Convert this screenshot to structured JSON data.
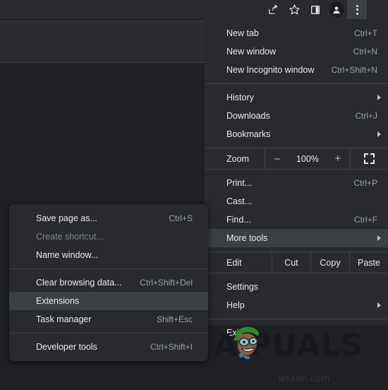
{
  "toolbar": {
    "icons": [
      {
        "name": "share-icon",
        "label": "Share this page"
      },
      {
        "name": "star-icon",
        "label": "Bookmark this tab"
      },
      {
        "name": "side-panel-icon",
        "label": "Side panel"
      },
      {
        "name": "profile-avatar-icon",
        "label": "Profile"
      },
      {
        "name": "three-dot-menu-icon",
        "label": "Customize and control Google Chrome"
      }
    ]
  },
  "main_menu": {
    "groups": [
      {
        "items": [
          {
            "label": "New tab",
            "accel": "Ctrl+T",
            "chevron": false,
            "highlight": false,
            "disabled": false
          },
          {
            "label": "New window",
            "accel": "Ctrl+N",
            "chevron": false,
            "highlight": false,
            "disabled": false
          },
          {
            "label": "New Incognito window",
            "accel": "Ctrl+Shift+N",
            "chevron": false,
            "highlight": false,
            "disabled": false
          }
        ]
      },
      {
        "items": [
          {
            "label": "History",
            "accel": "",
            "chevron": true,
            "highlight": false,
            "disabled": false
          },
          {
            "label": "Downloads",
            "accel": "Ctrl+J",
            "chevron": false,
            "highlight": false,
            "disabled": false
          },
          {
            "label": "Bookmarks",
            "accel": "",
            "chevron": true,
            "highlight": false,
            "disabled": false
          }
        ]
      }
    ],
    "zoom_row": {
      "label": "Zoom",
      "minus": "–",
      "value": "100%",
      "plus": "+",
      "fullscreen_icon": "fullscreen-icon"
    },
    "group_after_zoom": {
      "items": [
        {
          "label": "Print...",
          "accel": "Ctrl+P",
          "chevron": false,
          "highlight": false,
          "disabled": false
        },
        {
          "label": "Cast...",
          "accel": "",
          "chevron": false,
          "highlight": false,
          "disabled": false
        },
        {
          "label": "Find...",
          "accel": "Ctrl+F",
          "chevron": false,
          "highlight": false,
          "disabled": false
        },
        {
          "label": "More tools",
          "accel": "",
          "chevron": true,
          "highlight": true,
          "disabled": false
        }
      ]
    },
    "edit_row": {
      "label": "Edit",
      "cut": "Cut",
      "copy": "Copy",
      "paste": "Paste"
    },
    "group_bottom": {
      "items": [
        {
          "label": "Settings",
          "accel": "",
          "chevron": false,
          "highlight": false,
          "disabled": false
        },
        {
          "label": "Help",
          "accel": "",
          "chevron": true,
          "highlight": false,
          "disabled": false
        }
      ]
    },
    "group_exit": {
      "items": [
        {
          "label": "Exit",
          "accel": "",
          "chevron": false,
          "highlight": false,
          "disabled": false
        }
      ]
    }
  },
  "sub_menu": {
    "groups": [
      {
        "items": [
          {
            "label": "Save page as...",
            "accel": "Ctrl+S",
            "highlight": false,
            "disabled": false
          },
          {
            "label": "Create shortcut...",
            "accel": "",
            "highlight": false,
            "disabled": true
          },
          {
            "label": "Name window...",
            "accel": "",
            "highlight": false,
            "disabled": false
          }
        ]
      },
      {
        "items": [
          {
            "label": "Clear browsing data...",
            "accel": "Ctrl+Shift+Del",
            "highlight": false,
            "disabled": false
          },
          {
            "label": "Extensions",
            "accel": "",
            "highlight": true,
            "disabled": false
          },
          {
            "label": "Task manager",
            "accel": "Shift+Esc",
            "highlight": false,
            "disabled": false
          }
        ]
      },
      {
        "items": [
          {
            "label": "Developer tools",
            "accel": "Ctrl+Shift+I",
            "highlight": false,
            "disabled": false
          }
        ]
      }
    ]
  },
  "watermark": {
    "brand": "A   PUALS",
    "site": "wsxdn.com"
  },
  "colors": {
    "menu_bg": "#292a2d",
    "page_bg": "#1f2023",
    "highlight": "#3c4043",
    "text": "#e8eaed",
    "muted": "#9aa0a6",
    "disabled": "#80868b",
    "separator": "#3f4145"
  }
}
